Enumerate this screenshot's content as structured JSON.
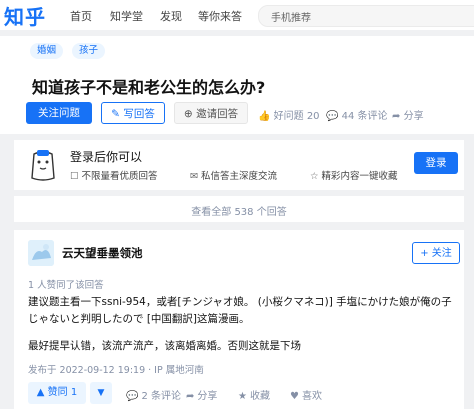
{
  "header": {
    "logo": "知乎",
    "nav": [
      "首页",
      "知学堂",
      "发现",
      "等你来答"
    ],
    "search_placeholder": "手机推荐"
  },
  "question": {
    "tags": [
      "婚姻",
      "孩子"
    ],
    "title": "知道孩子不是和老公生的怎么办?",
    "follow_button": "关注问题",
    "answer_button": "写回答",
    "invite_button": "邀请回答",
    "good_question": "好问题 20",
    "comments": "44 条评论",
    "share": "分享"
  },
  "login_prompt": {
    "title": "登录后你可以",
    "perks": [
      "不限量看优质回答",
      "私信答主深度交流",
      "精彩内容一键收藏"
    ],
    "login_button": "登录"
  },
  "view_all": "查看全部 538 个回答",
  "answer": {
    "author": "云天望垂墨领池",
    "follow_button": "关注",
    "upvote_info": "1 人赞同了该回答",
    "para1": "建议题主看一下ssni-954，或者[チンジャオ娘。 (小桜クマネコ)] 手塩にかけた娘が俺の子じゃないと判明したので [中国翻訳]这篇漫画。",
    "para2": "最好提早认错，该流产流产，该离婚离婚。否则这就是下场",
    "publish_time": "发布于 2022-09-12 19:19 · IP 属地河南",
    "upvote_button": "赞同 1",
    "comments": "2 条评论",
    "share": "分享",
    "favorite": "收藏",
    "like": "喜欢"
  },
  "colors": {
    "accent": "#1772f6",
    "muted": "#8590a6",
    "page_bg": "#f0f1f3"
  },
  "icons": [
    "pencil-icon",
    "person-plus-icon",
    "thumb-up-icon",
    "comment-icon",
    "share-icon",
    "checkbox-icon",
    "message-icon",
    "star-icon",
    "triangle-up-icon",
    "triangle-down-icon",
    "heart-icon",
    "mascot-icon"
  ]
}
